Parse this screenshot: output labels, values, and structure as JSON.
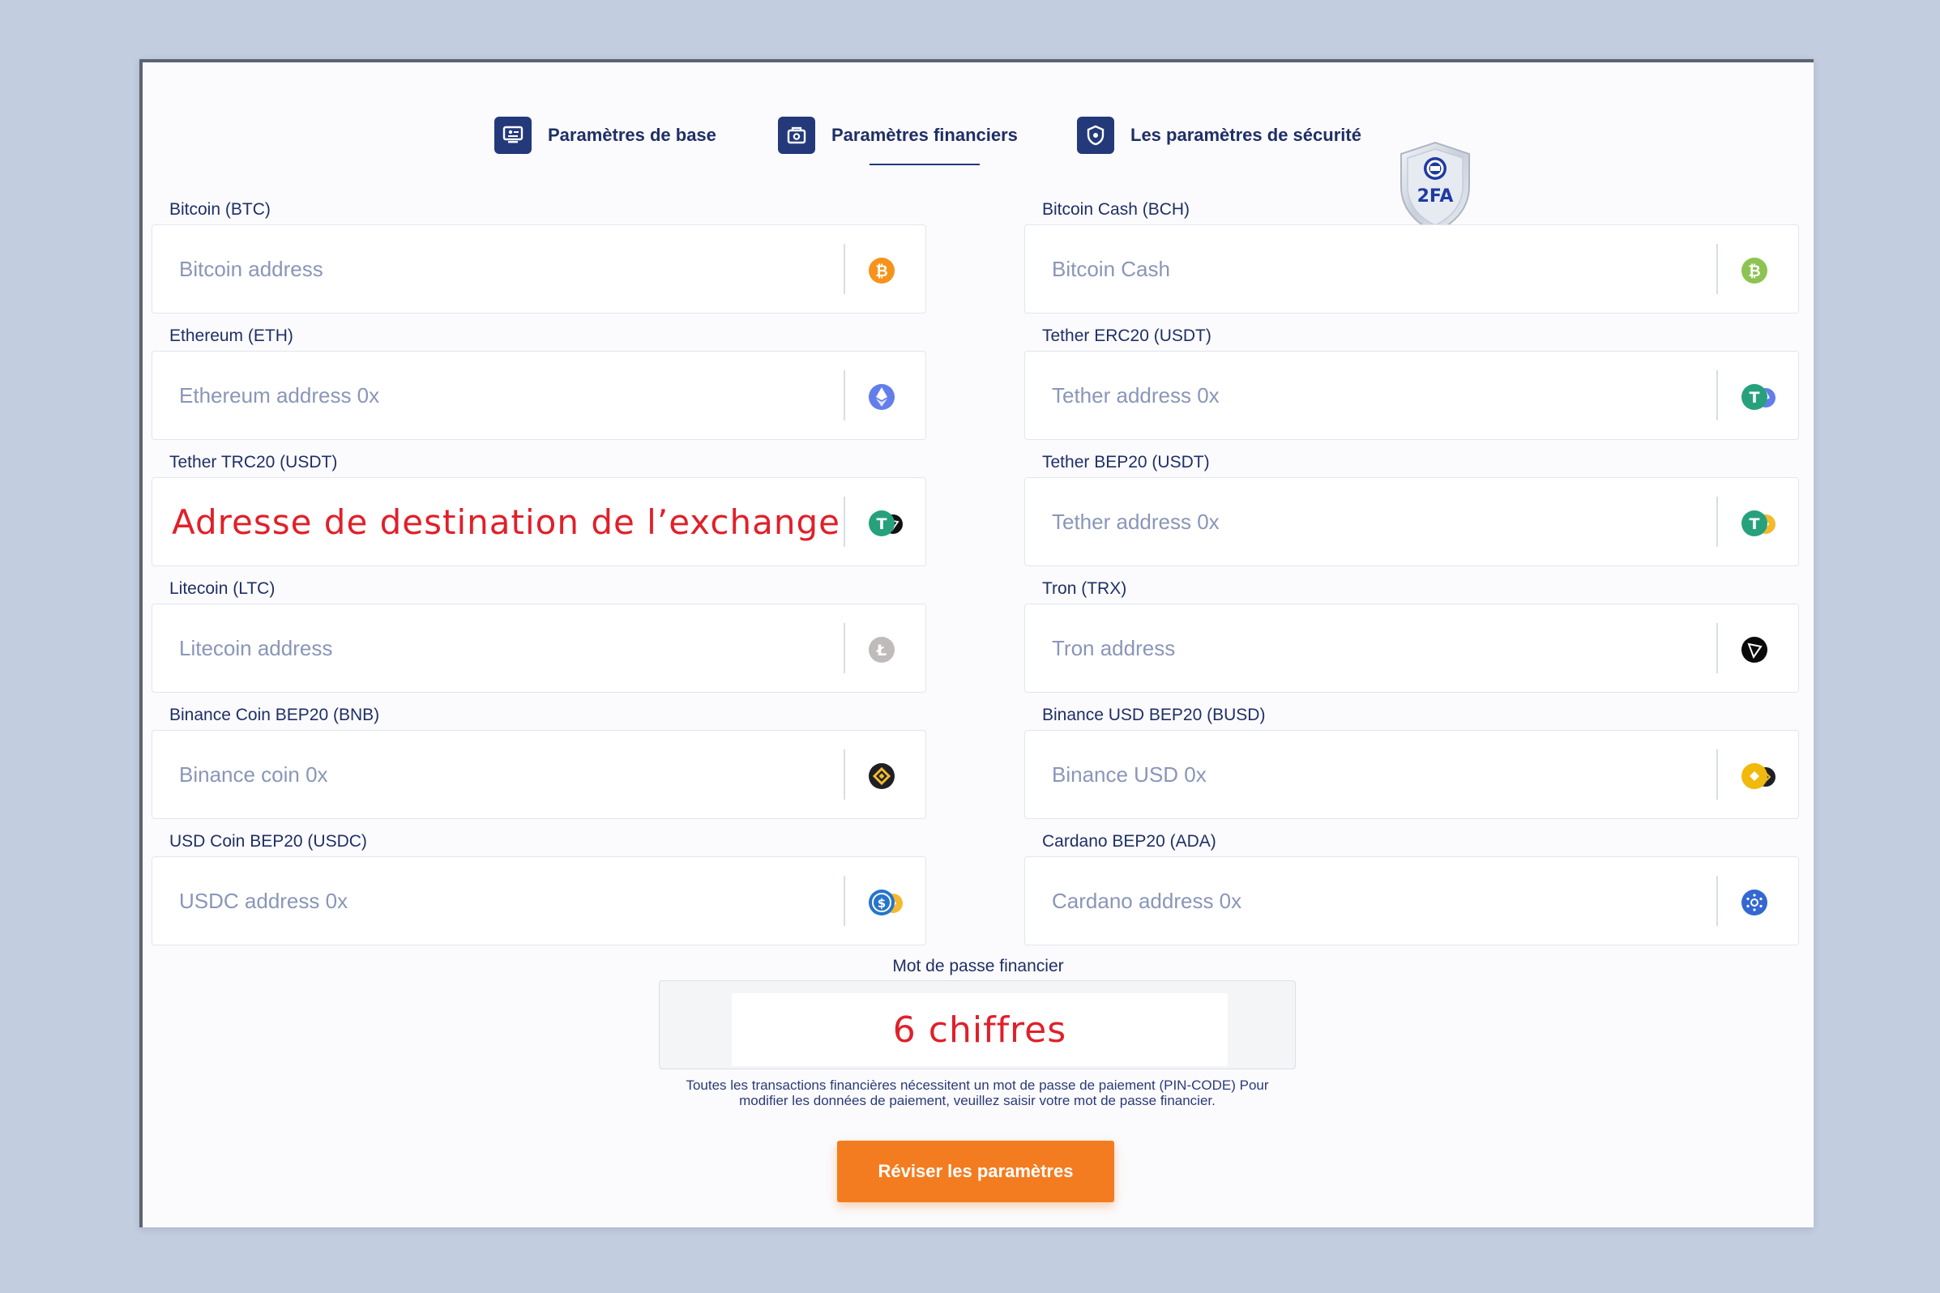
{
  "tabs": [
    {
      "label": "Paramètres de base",
      "icon": "monitor-icon"
    },
    {
      "label": "Paramètres financiers",
      "icon": "wallet-icon",
      "active": true
    },
    {
      "label": "Les paramètres de sécurité",
      "icon": "shield-icon"
    }
  ],
  "badge": {
    "text": "2FA"
  },
  "fields": {
    "btc": {
      "label": "Bitcoin (BTC)",
      "placeholder": "Bitcoin address",
      "icon": "bitcoin-icon",
      "color": "#f7931a"
    },
    "bch": {
      "label": "Bitcoin Cash (BCH)",
      "placeholder": "Bitcoin Cash",
      "icon": "bitcoin-cash-icon",
      "color": "#8dc351"
    },
    "eth": {
      "label": "Ethereum (ETH)",
      "placeholder": "Ethereum address 0x",
      "icon": "ethereum-icon",
      "color": "#627eea"
    },
    "usdt_erc20": {
      "label": "Tether ERC20 (USDT)",
      "placeholder": "Tether address 0x",
      "icon": "tether-erc20-icon",
      "color": "#26a17b"
    },
    "usdt_trc20": {
      "label": "Tether TRC20 (USDT)",
      "value": "Adresse de destination de l’exchange",
      "icon": "tether-trc20-icon",
      "color": "#26a17b"
    },
    "usdt_bep20": {
      "label": "Tether BEP20 (USDT)",
      "placeholder": "Tether address 0x",
      "icon": "tether-bep20-icon",
      "color": "#26a17b"
    },
    "ltc": {
      "label": "Litecoin (LTC)",
      "placeholder": "Litecoin address",
      "icon": "litecoin-icon",
      "color": "#bfbbbb"
    },
    "trx": {
      "label": "Tron (TRX)",
      "placeholder": "Tron address",
      "icon": "tron-icon",
      "color": "#000000"
    },
    "bnb": {
      "label": "Binance Coin BEP20 (BNB)",
      "placeholder": "Binance coin 0x",
      "icon": "binance-coin-icon",
      "color": "#f3ba2f"
    },
    "busd": {
      "label": "Binance USD BEP20 (BUSD)",
      "placeholder": "Binance USD 0x",
      "icon": "binance-usd-icon",
      "color": "#f0b90b"
    },
    "usdc": {
      "label": "USD Coin BEP20 (USDC)",
      "placeholder": "USDC address 0x",
      "icon": "usd-coin-icon",
      "color": "#2775ca"
    },
    "ada": {
      "label": "Cardano BEP20 (ADA)",
      "placeholder": "Cardano address 0x",
      "icon": "cardano-icon",
      "color": "#3468d1"
    }
  },
  "password": {
    "label": "Mot de passe financier",
    "value": "6 chiffres",
    "help": "Toutes les transactions financières nécessitent un mot de passe de paiement (PIN-CODE) Pour modifier les données de paiement, veuillez saisir votre mot de passe financier."
  },
  "submit": {
    "label": "Réviser les paramètres"
  },
  "colors": {
    "accent": "#f47c20",
    "primary": "#23397a",
    "annotation": "#e0202a"
  }
}
